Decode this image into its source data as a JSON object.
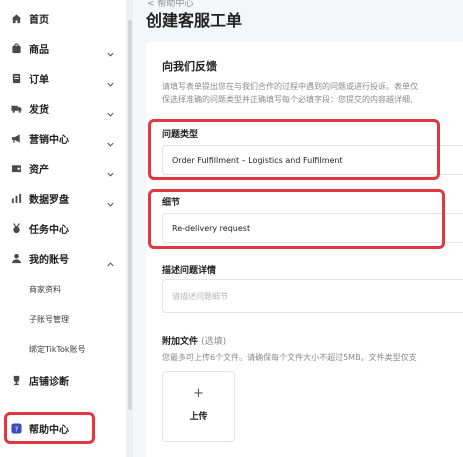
{
  "sidebar": {
    "items": [
      {
        "label": "首页",
        "icon": "home-icon",
        "chevron": false
      },
      {
        "label": "商品",
        "icon": "bag-icon",
        "chevron": true
      },
      {
        "label": "订单",
        "icon": "order-icon",
        "chevron": true
      },
      {
        "label": "发货",
        "icon": "truck-icon",
        "chevron": true
      },
      {
        "label": "营销中心",
        "icon": "megaphone-icon",
        "chevron": true
      },
      {
        "label": "资产",
        "icon": "wallet-icon",
        "chevron": true
      },
      {
        "label": "数据罗盘",
        "icon": "bar-chart-icon",
        "chevron": true
      },
      {
        "label": "任务中心",
        "icon": "medal-icon",
        "chevron": false
      },
      {
        "label": "我的账号",
        "icon": "user-icon",
        "chevron": "up"
      }
    ],
    "account_subitems": [
      "商家资料",
      "子账号管理",
      "绑定TikTok账号"
    ],
    "store_diagnosis": "店铺诊断",
    "help_center": "帮助中心"
  },
  "main": {
    "breadcrumb": "< 帮助中心",
    "page_title": "创建客服工单",
    "section_title": "向我们反馈",
    "section_desc_line1": "请填写表单提出您在与我们合作的过程中遇到的问题或进行投诉。表单仅",
    "section_desc_line2": "保选择准确的问题类型并正确填写每个必填字段：您提交的内容越详细,",
    "issue_type_label": "问题类型",
    "issue_type_value": "Order Fulfillment – Logistics and Fulfilment",
    "detail_label": "细节",
    "detail_value": "Re-delivery request",
    "describe_label": "描述问题详情",
    "describe_placeholder": "请描述问题细节",
    "attach_label": "附加文件",
    "attach_optional": "(选填)",
    "attach_desc": "您最多可上传6个文件。请确保每个文件大小不超过5MB。文件类型仅支",
    "upload_plus": "+",
    "upload_label": "上传"
  },
  "colors": {
    "highlight": "#e0383e",
    "sidebar_bg": "#ffffff",
    "page_bg": "#f5f6f7"
  }
}
